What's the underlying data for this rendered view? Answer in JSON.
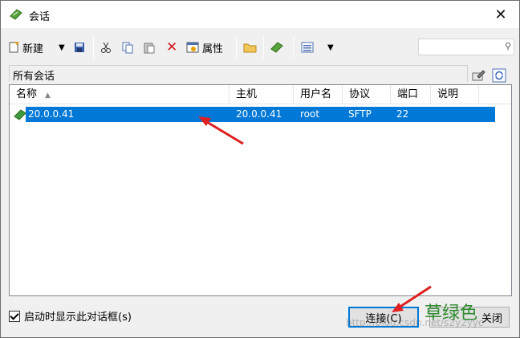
{
  "window": {
    "title": "会话"
  },
  "toolbar": {
    "new_label": "新建",
    "properties_label": "属性",
    "search_placeholder": ""
  },
  "group": {
    "label": "所有会话"
  },
  "columns": [
    {
      "label": "名称"
    },
    {
      "label": "主机"
    },
    {
      "label": "用户名"
    },
    {
      "label": "协议"
    },
    {
      "label": "端口"
    },
    {
      "label": "说明"
    }
  ],
  "sessions": [
    {
      "name": "20.0.0.41",
      "host": "20.0.0.41",
      "user": "root",
      "protocol": "SFTP",
      "port": "22",
      "desc": ""
    }
  ],
  "footer": {
    "show_on_startup_label": "启动时显示此对话框(s)",
    "connect_label": "连接(C)",
    "close_label": "关闭"
  },
  "annotations": {
    "overlay_label": "草绿色",
    "watermark": "http://blog.csdn.net/s2y2yyc"
  },
  "colors": {
    "selection": "#0078d7",
    "arrow": "#e02020",
    "overlay_text": "#2e8b2e",
    "session_icon": "#3e9a3e"
  }
}
